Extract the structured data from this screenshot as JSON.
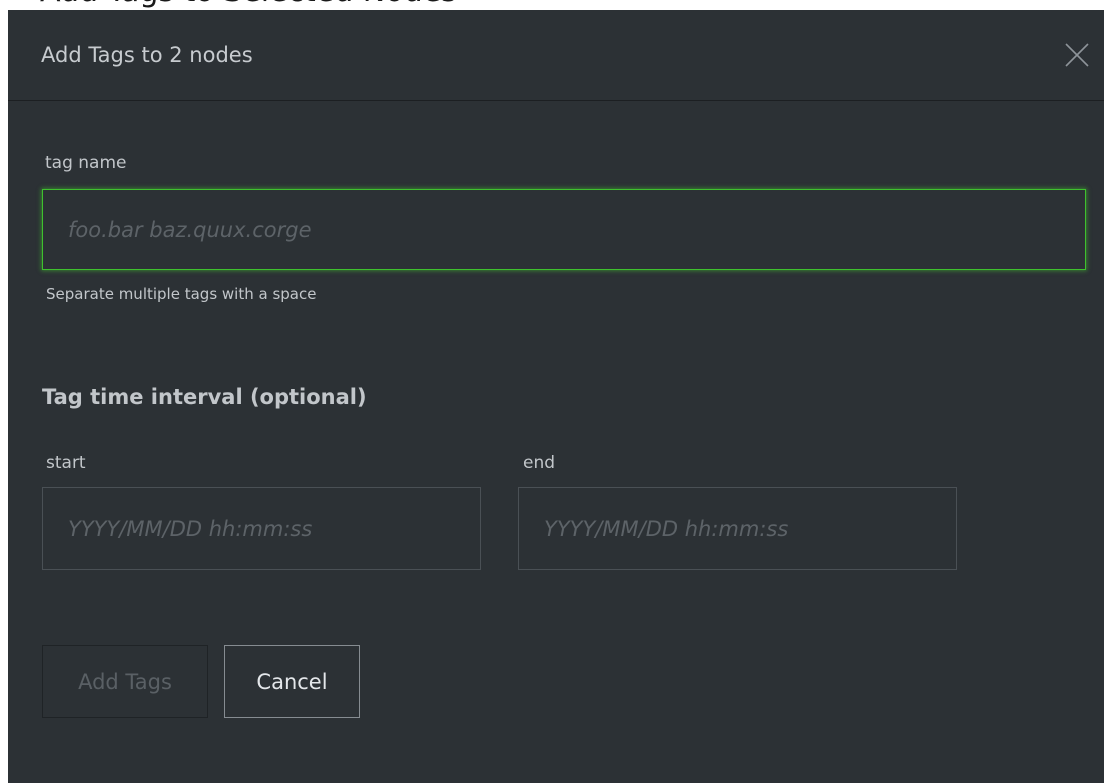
{
  "background_title": "Add Tags to Selected Nodes",
  "dialog": {
    "title": "Add Tags to 2 nodes",
    "close_icon": "close-icon"
  },
  "tag_name": {
    "label": "tag name",
    "placeholder": "foo.bar baz.quux.corge",
    "value": "",
    "help": "Separate multiple tags with a space"
  },
  "interval": {
    "heading": "Tag time interval (optional)",
    "start": {
      "label": "start",
      "placeholder": "YYYY/MM/DD hh:mm:ss",
      "value": ""
    },
    "end": {
      "label": "end",
      "placeholder": "YYYY/MM/DD hh:mm:ss",
      "value": ""
    }
  },
  "buttons": {
    "add_label": "Add Tags",
    "add_enabled": false,
    "cancel_label": "Cancel"
  },
  "colors": {
    "dialog_bg": "#2c3135",
    "focus_border": "#3fc12e",
    "label_text": "#c2c6ca",
    "placeholder_text": "#5d6368"
  }
}
